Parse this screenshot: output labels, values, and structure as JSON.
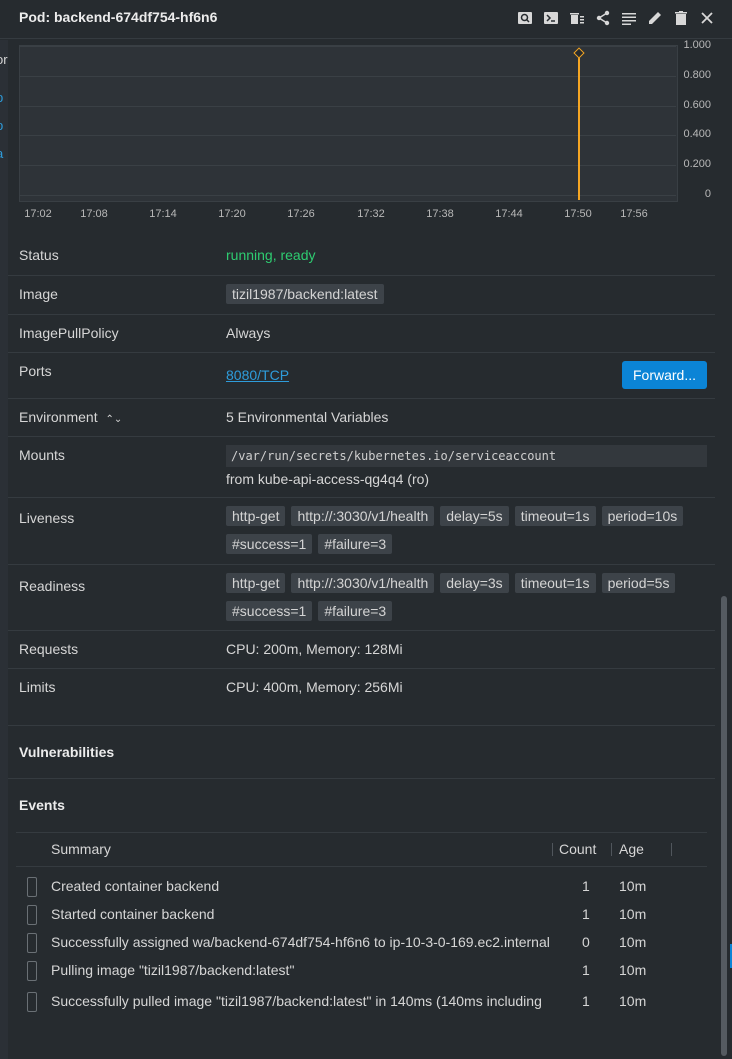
{
  "header": {
    "title": "Pod: backend-674df754-hf6n6",
    "icons": [
      "search-icon",
      "terminal-icon",
      "delete-pods-icon",
      "share-icon",
      "logs-icon",
      "edit-icon",
      "trash-icon",
      "close-icon"
    ]
  },
  "left_strip": [
    "or",
    "p",
    "p",
    "a"
  ],
  "chart_data": {
    "type": "line",
    "x": [
      "17:02",
      "17:08",
      "17:14",
      "17:20",
      "17:26",
      "17:32",
      "17:38",
      "17:44",
      "17:50",
      "17:56"
    ],
    "yticks": [
      "1.000",
      "0.800",
      "0.600",
      "0.400",
      "0.200",
      "0"
    ],
    "ylim": [
      0,
      1
    ],
    "series": [
      {
        "points": [
          {
            "x": "17:51",
            "y": 0.95
          }
        ],
        "color": "#f5a623"
      }
    ],
    "grid": true
  },
  "details": {
    "status": {
      "label": "Status",
      "value": "running, ready"
    },
    "image": {
      "label": "Image",
      "value": "tizil1987/backend:latest"
    },
    "pull_policy": {
      "label": "ImagePullPolicy",
      "value": "Always"
    },
    "ports": {
      "label": "Ports",
      "value": "8080/TCP",
      "button": "Forward..."
    },
    "environment": {
      "label": "Environment",
      "value": "5 Environmental Variables"
    },
    "mounts": {
      "label": "Mounts",
      "path": "/var/run/secrets/kubernetes.io/serviceaccount",
      "from": "from kube-api-access-qg4q4 (ro)"
    },
    "liveness": {
      "label": "Liveness",
      "chips": [
        "http-get",
        "http://:3030/v1/health",
        "delay=5s",
        "timeout=1s",
        "period=10s",
        "#success=1",
        "#failure=3"
      ]
    },
    "readiness": {
      "label": "Readiness",
      "chips": [
        "http-get",
        "http://:3030/v1/health",
        "delay=3s",
        "timeout=1s",
        "period=5s",
        "#success=1",
        "#failure=3"
      ]
    },
    "requests": {
      "label": "Requests",
      "value": "CPU: 200m, Memory: 128Mi"
    },
    "limits": {
      "label": "Limits",
      "value": "CPU: 400m, Memory: 256Mi"
    }
  },
  "vulnerabilities": {
    "title": "Vulnerabilities"
  },
  "events": {
    "title": "Events",
    "columns": {
      "summary": "Summary",
      "count": "Count",
      "age": "Age"
    },
    "rows": [
      {
        "summary": "Created container backend",
        "count": "1",
        "age": "10m"
      },
      {
        "summary": "Started container backend",
        "count": "1",
        "age": "10m"
      },
      {
        "summary": "Successfully assigned wa/backend-674df754-hf6n6 to ip-10-3-0-169.ec2.internal",
        "count": "0",
        "age": "10m"
      },
      {
        "summary": "Pulling image \"tizil1987/backend:latest\"",
        "count": "1",
        "age": "10m"
      },
      {
        "summary": "Successfully pulled image \"tizil1987/backend:latest\" in 140ms (140ms including",
        "count": "1",
        "age": "10m"
      }
    ]
  }
}
